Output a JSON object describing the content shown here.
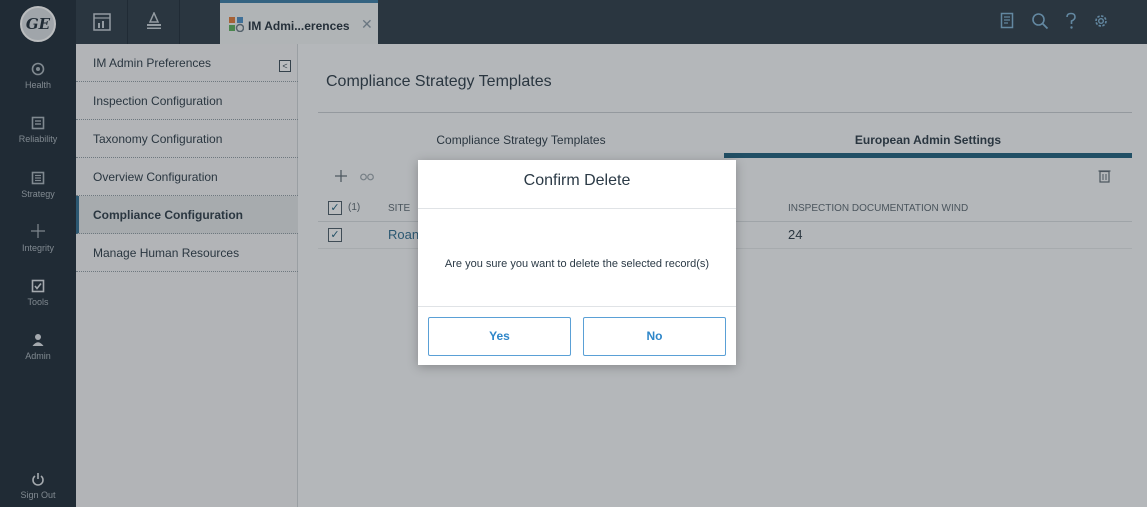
{
  "rail": {
    "logo_text": "GE",
    "items": [
      {
        "label": "Health",
        "icon": "health-icon"
      },
      {
        "label": "Reliability",
        "icon": "reliability-icon"
      },
      {
        "label": "Strategy",
        "icon": "strategy-icon"
      },
      {
        "label": "Integrity",
        "icon": "integrity-icon"
      },
      {
        "label": "Tools",
        "icon": "tools-icon"
      },
      {
        "label": "Admin",
        "icon": "admin-icon"
      },
      {
        "label": "Sign Out",
        "icon": "power-icon"
      }
    ]
  },
  "topbar": {
    "active_tab_label": "IM Admi...erences",
    "close_glyph": "✕"
  },
  "sidenav": {
    "items": [
      {
        "label": "IM Admin Preferences"
      },
      {
        "label": "Inspection Configuration"
      },
      {
        "label": "Taxonomy Configuration"
      },
      {
        "label": "Overview Configuration"
      },
      {
        "label": "Compliance Configuration"
      },
      {
        "label": "Manage Human Resources"
      }
    ],
    "collapse_glyph": "<"
  },
  "main": {
    "title": "Compliance Strategy Templates",
    "tabs": [
      {
        "label": "Compliance Strategy Templates"
      },
      {
        "label": "European Admin Settings"
      }
    ],
    "grid": {
      "selected_count": "(1)",
      "columns": [
        "SITE",
        "INSPECTION DOCUMENTATION WIND"
      ],
      "rows": [
        {
          "site": "Roan",
          "inspection_doc_wind": "24"
        }
      ]
    }
  },
  "modal": {
    "title": "Confirm Delete",
    "message": "Are you sure you want to delete the selected record(s)",
    "yes_label": "Yes",
    "no_label": "No"
  },
  "colors": {
    "rail_bg": "#1d2a35",
    "topbar_bg": "#2b3a46",
    "accent": "#1e5f7c",
    "button_text": "#2e86c9"
  }
}
